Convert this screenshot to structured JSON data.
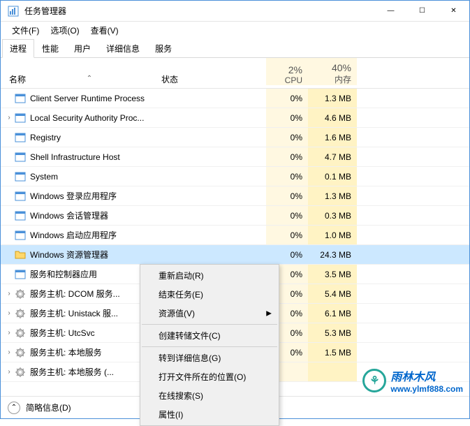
{
  "window": {
    "title": "任务管理器"
  },
  "titlebar_controls": {
    "min": "—",
    "max": "☐",
    "close": "✕"
  },
  "menus": {
    "file": "文件(F)",
    "options": "选项(O)",
    "view": "查看(V)"
  },
  "tabs": {
    "processes": "进程",
    "performance": "性能",
    "users": "用户",
    "details": "详细信息",
    "services": "服务"
  },
  "headers": {
    "name": "名称",
    "status": "状态",
    "cpu_pct": "2%",
    "cpu_lbl": "CPU",
    "mem_pct": "40%",
    "mem_lbl": "内存",
    "sort_indicator": "⌃"
  },
  "processes": [
    {
      "name": "Client Server Runtime Process",
      "cpu": "0%",
      "mem": "1.3 MB",
      "icon": "app",
      "expandable": false
    },
    {
      "name": "Local Security Authority Proc...",
      "cpu": "0%",
      "mem": "4.6 MB",
      "icon": "app",
      "expandable": true
    },
    {
      "name": "Registry",
      "cpu": "0%",
      "mem": "1.6 MB",
      "icon": "app",
      "expandable": false
    },
    {
      "name": "Shell Infrastructure Host",
      "cpu": "0%",
      "mem": "4.7 MB",
      "icon": "app",
      "expandable": false
    },
    {
      "name": "System",
      "cpu": "0%",
      "mem": "0.1 MB",
      "icon": "app",
      "expandable": false
    },
    {
      "name": "Windows 登录应用程序",
      "cpu": "0%",
      "mem": "1.3 MB",
      "icon": "app",
      "expandable": false
    },
    {
      "name": "Windows 会话管理器",
      "cpu": "0%",
      "mem": "0.3 MB",
      "icon": "app",
      "expandable": false
    },
    {
      "name": "Windows 启动应用程序",
      "cpu": "0%",
      "mem": "1.0 MB",
      "icon": "app",
      "expandable": false
    },
    {
      "name": "Windows 资源管理器",
      "cpu": "0%",
      "mem": "24.3 MB",
      "icon": "folder",
      "expandable": false,
      "selected": true
    },
    {
      "name": "服务和控制器应用",
      "cpu": "0%",
      "mem": "3.5 MB",
      "icon": "app",
      "expandable": false
    },
    {
      "name": "服务主机: DCOM 服务...",
      "cpu": "0%",
      "mem": "5.4 MB",
      "icon": "gear",
      "expandable": true
    },
    {
      "name": "服务主机: Unistack 服...",
      "cpu": "0%",
      "mem": "6.1 MB",
      "icon": "gear",
      "expandable": true
    },
    {
      "name": "服务主机: UtcSvc",
      "cpu": "0%",
      "mem": "5.3 MB",
      "icon": "gear",
      "expandable": true
    },
    {
      "name": "服务主机: 本地服务",
      "cpu": "0%",
      "mem": "1.5 MB",
      "icon": "gear",
      "expandable": true
    },
    {
      "name": "服务主机: 本地服务 (...",
      "cpu": "",
      "mem": "",
      "icon": "gear",
      "expandable": true
    }
  ],
  "context_menu": {
    "restart": "重新启动(R)",
    "end_task": "结束任务(E)",
    "resource_values": "资源值(V)",
    "create_dump": "创建转储文件(C)",
    "goto_details": "转到详细信息(G)",
    "open_location": "打开文件所在的位置(O)",
    "search_online": "在线搜索(S)",
    "properties": "属性(I)"
  },
  "footer": {
    "fewer_details": "简略信息(D)",
    "arrow": "⌃"
  },
  "watermark": {
    "title": "雨林木风",
    "url": "www.ylmf888.com",
    "leaf": "⚘"
  }
}
